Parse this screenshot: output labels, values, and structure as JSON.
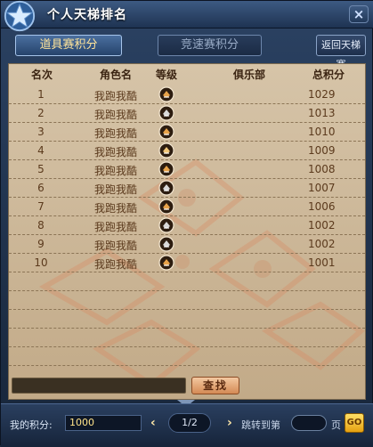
{
  "window": {
    "title": "个人天梯排名",
    "close_symbol": "×"
  },
  "tabs": [
    {
      "label": "道具赛积分",
      "active": true
    },
    {
      "label": "竞速赛积分",
      "active": false
    }
  ],
  "back_button": "返回天梯赛",
  "table": {
    "headers": [
      "名次",
      "角色名",
      "等级",
      "俱乐部",
      "总积分"
    ],
    "rows": [
      {
        "rank": "1",
        "name": "我跑我酷",
        "level_icon": "rank-badge-icon",
        "club": "",
        "score": "1029"
      },
      {
        "rank": "2",
        "name": "我跑我酷",
        "level_icon": "rank-badge-icon",
        "club": "",
        "score": "1013"
      },
      {
        "rank": "3",
        "name": "我跑我酷",
        "level_icon": "rank-badge-icon",
        "club": "",
        "score": "1010"
      },
      {
        "rank": "4",
        "name": "我跑我酷",
        "level_icon": "rank-badge-icon",
        "club": "",
        "score": "1009"
      },
      {
        "rank": "5",
        "name": "我跑我酷",
        "level_icon": "rank-badge-icon",
        "club": "",
        "score": "1008"
      },
      {
        "rank": "6",
        "name": "我跑我酷",
        "level_icon": "rank-badge-icon",
        "club": "",
        "score": "1007"
      },
      {
        "rank": "7",
        "name": "我跑我酷",
        "level_icon": "rank-badge-icon",
        "club": "",
        "score": "1006"
      },
      {
        "rank": "8",
        "name": "我跑我酷",
        "level_icon": "rank-badge-icon",
        "club": "",
        "score": "1002"
      },
      {
        "rank": "9",
        "name": "我跑我酷",
        "level_icon": "rank-badge-icon",
        "club": "",
        "score": "1002"
      },
      {
        "rank": "10",
        "name": "我跑我酷",
        "level_icon": "rank-badge-icon",
        "club": "",
        "score": "1001"
      }
    ]
  },
  "search": {
    "value": "",
    "button_label": "查找"
  },
  "footer": {
    "my_score_label": "我的积分:",
    "my_score_value": "1000",
    "prev_symbol": "‹",
    "next_symbol": "›",
    "page_indicator": "1/2",
    "jump_label": "跳转到第",
    "jump_value": "",
    "page_unit": "页",
    "go_label": "GO"
  },
  "colors": {
    "panel": "#c9b496",
    "text_brown": "#5b3a1d",
    "highlight_yellow": "#ffe38a"
  }
}
